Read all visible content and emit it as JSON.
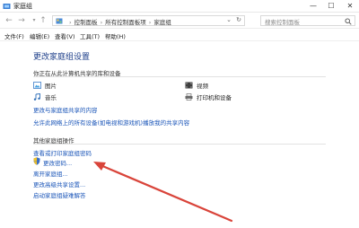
{
  "window": {
    "title": "家庭组",
    "minimize": "—",
    "maximize": "☐",
    "close": "✕"
  },
  "nav": {
    "back": "←",
    "forward": "→",
    "up": "↑",
    "address": {
      "crumbs": [
        "控制面板",
        "所有控制面板项",
        "家庭组"
      ],
      "separator": "›"
    },
    "search_placeholder": "搜索控制面板"
  },
  "menu": [
    "文件(F)",
    "编辑(E)",
    "查看(V)",
    "工具(T)",
    "帮助(H)"
  ],
  "main": {
    "title": "更改家庭组设置",
    "shared_section": {
      "label": "你正在从此计算机共享的库和设备",
      "libraries": [
        {
          "label": "图片",
          "icon": "pictures-icon"
        },
        {
          "label": "视频",
          "icon": "videos-icon"
        },
        {
          "label": "音乐",
          "icon": "music-icon"
        },
        {
          "label": "打印机和设备",
          "icon": "printer-icon"
        }
      ],
      "links": [
        "更改与家庭组共享的内容",
        "允许此网络上的所有设备(如电视和游戏机)播放我的共享内容"
      ]
    },
    "other_section": {
      "label": "其他家庭组操作",
      "links": [
        "查看或打印家庭组密码",
        "更改密码...",
        "离开家庭组...",
        "更改高级共享设置...",
        "启动家庭组疑难解答"
      ]
    }
  },
  "colors": {
    "link": "#1a55b8",
    "heading": "#1e3f8a",
    "annotation_arrow": "#d9443a"
  }
}
